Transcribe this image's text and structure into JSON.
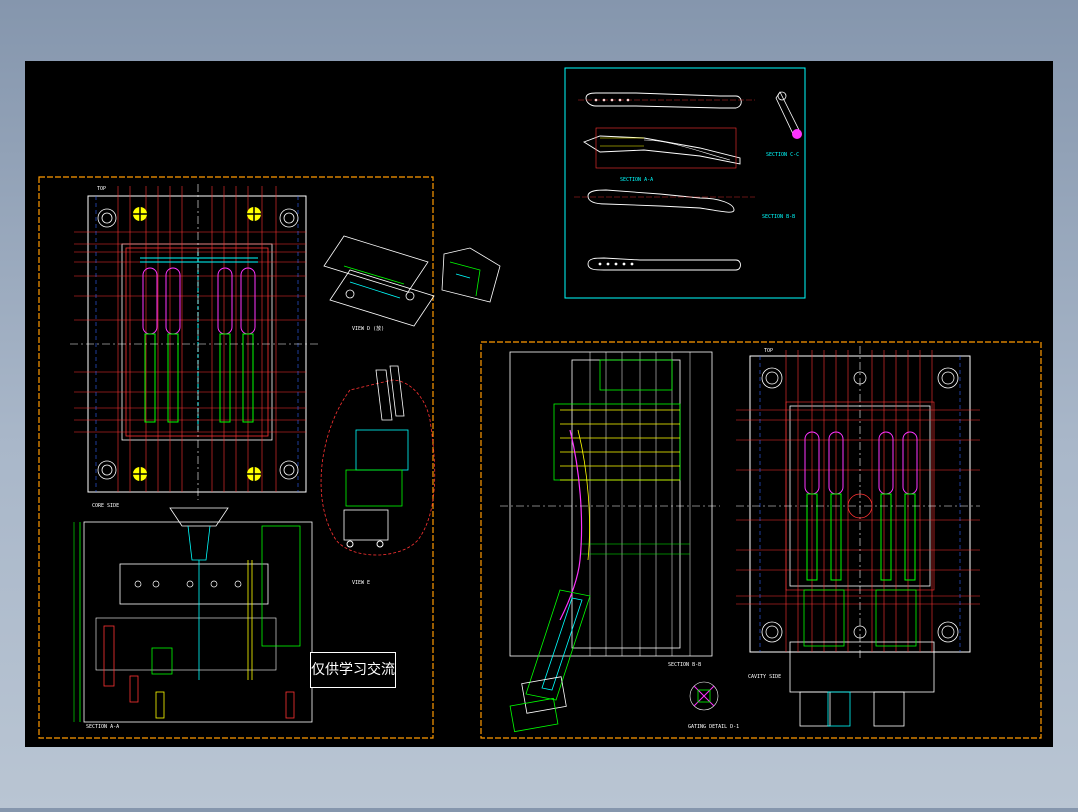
{
  "colors": {
    "background_outer": "#8c9db3",
    "canvas": "#000000",
    "frame": "#ff9900",
    "white": "#ffffff",
    "red": "#ff3333",
    "cyan": "#00ffff",
    "green": "#00ff00",
    "yellow": "#ffff00",
    "magenta": "#ff33ff",
    "blue": "#3366ff"
  },
  "watermark": {
    "text": "仅供学习交流"
  },
  "labels": {
    "top_left": "TOP",
    "core_side": "CORE SIDE",
    "section_a_a_left": "SECTION A-A",
    "view_d": "VIEW D (放)",
    "view_e": "VIEW E",
    "section_a_a_product": "SECTION A-A",
    "section_b_b_product": "SECTION B-B",
    "section_c_c": "SECTION C-C",
    "section_b_b_right": "SECTION B-B",
    "gating_detail": "GATING DETAIL D-1",
    "top_right": "TOP",
    "cavity_side": "CAVITY SIDE"
  }
}
